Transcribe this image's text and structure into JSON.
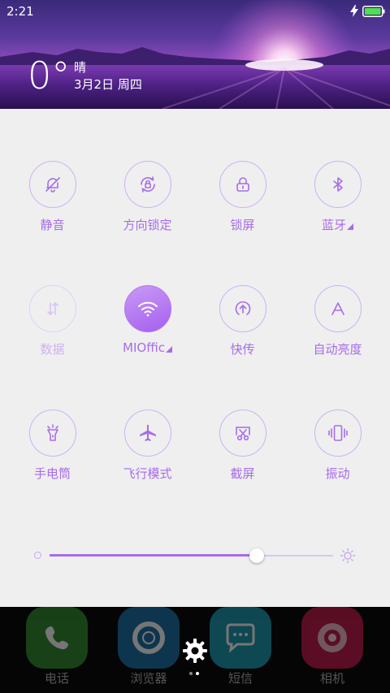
{
  "status_bar": {
    "time": "2:21",
    "battery_icon": "battery-charging-icon"
  },
  "weather": {
    "temperature": "0°",
    "condition": "晴",
    "date": "3月2日 周四"
  },
  "toggles": [
    {
      "id": "mute",
      "label": "静音",
      "icon": "bell-off-icon",
      "state": "off"
    },
    {
      "id": "rotation-lock",
      "label": "方向锁定",
      "icon": "rotation-lock-icon",
      "state": "off"
    },
    {
      "id": "lock-screen",
      "label": "锁屏",
      "icon": "lock-icon",
      "state": "off"
    },
    {
      "id": "bluetooth",
      "label": "蓝牙",
      "icon": "bluetooth-icon",
      "state": "off",
      "has_menu": true
    },
    {
      "id": "data",
      "label": "数据",
      "icon": "data-arrows-icon",
      "state": "disabled"
    },
    {
      "id": "wifi",
      "label": "MIOffic",
      "icon": "wifi-icon",
      "state": "on",
      "has_menu": true
    },
    {
      "id": "quick-share",
      "label": "快传",
      "icon": "upload-icon",
      "state": "off"
    },
    {
      "id": "auto-brightness",
      "label": "自动亮度",
      "icon": "auto-brightness-icon",
      "state": "off"
    },
    {
      "id": "flashlight",
      "label": "手电筒",
      "icon": "flashlight-icon",
      "state": "off"
    },
    {
      "id": "airplane",
      "label": "飞行模式",
      "icon": "airplane-icon",
      "state": "off"
    },
    {
      "id": "screenshot",
      "label": "截屏",
      "icon": "scissors-icon",
      "state": "off"
    },
    {
      "id": "vibrate",
      "label": "振动",
      "icon": "vibrate-icon",
      "state": "off"
    }
  ],
  "brightness": {
    "level": 0.73,
    "low_icon": "brightness-low-icon",
    "high_icon": "sun-icon"
  },
  "dock": {
    "apps": [
      {
        "label": "电话",
        "icon": "phone-icon",
        "color": "#2f8a2f"
      },
      {
        "label": "浏览器",
        "icon": "browser-icon",
        "color": "#1a6fa8"
      },
      {
        "label": "短信",
        "icon": "message-icon",
        "color": "#1b9ab0"
      },
      {
        "label": "相机",
        "icon": "camera-icon",
        "color": "#c2184a"
      }
    ],
    "settings_icon": "gear-icon",
    "page_count": 2,
    "current_page": 2
  },
  "colors": {
    "accent": "#a66de8",
    "accent_light": "#cdb2f2",
    "panel_bg": "#efefef"
  }
}
